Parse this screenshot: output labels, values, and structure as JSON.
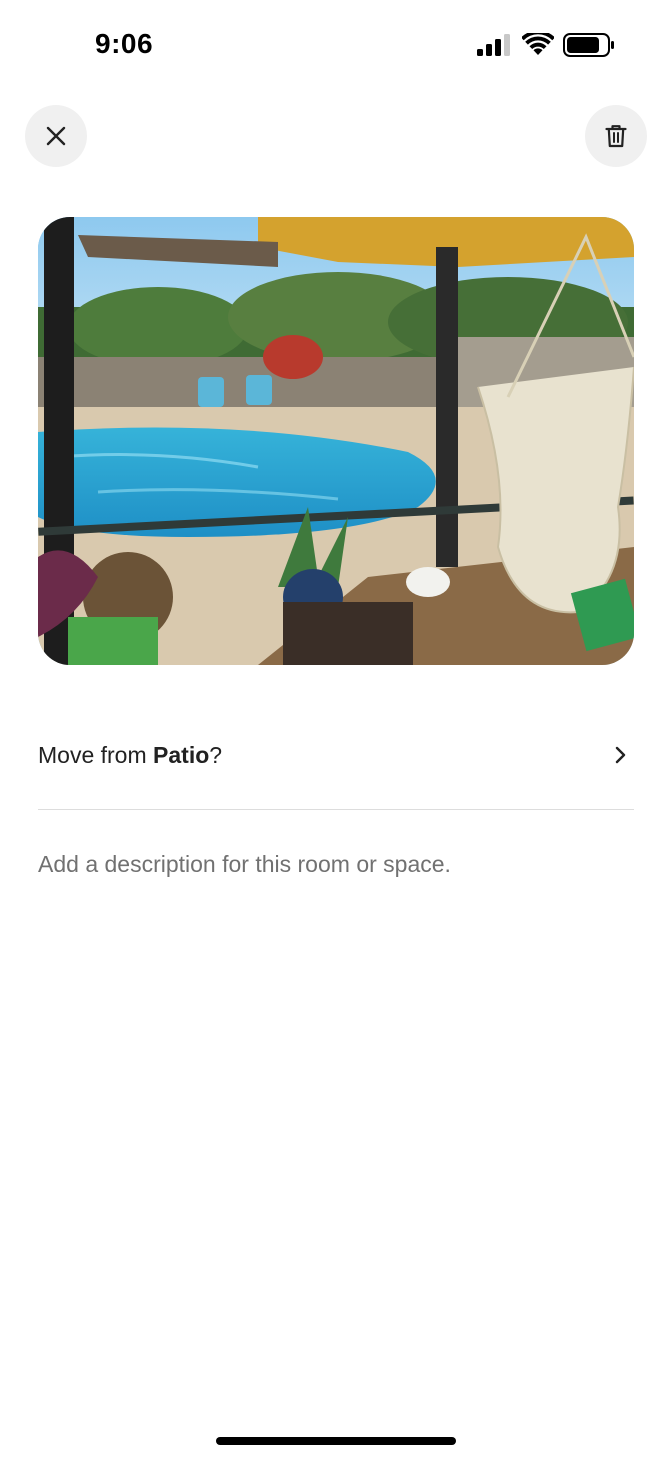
{
  "status_bar": {
    "time": "9:06",
    "signal_icon": "cellular-signal-icon",
    "wifi_icon": "wifi-icon",
    "battery_icon": "battery-icon"
  },
  "header": {
    "close_icon": "close-icon",
    "delete_icon": "trash-icon"
  },
  "photo": {
    "subject": "patio-pool-photo"
  },
  "move": {
    "prefix": "Move from ",
    "room": "Patio",
    "suffix": "?",
    "chevron_icon": "chevron-right-icon"
  },
  "description": {
    "placeholder": "Add a description for this room or space."
  },
  "colors": {
    "text_primary": "#222222",
    "text_secondary": "#717171",
    "button_bg": "#f0f0f0",
    "divider": "#dddddd"
  }
}
